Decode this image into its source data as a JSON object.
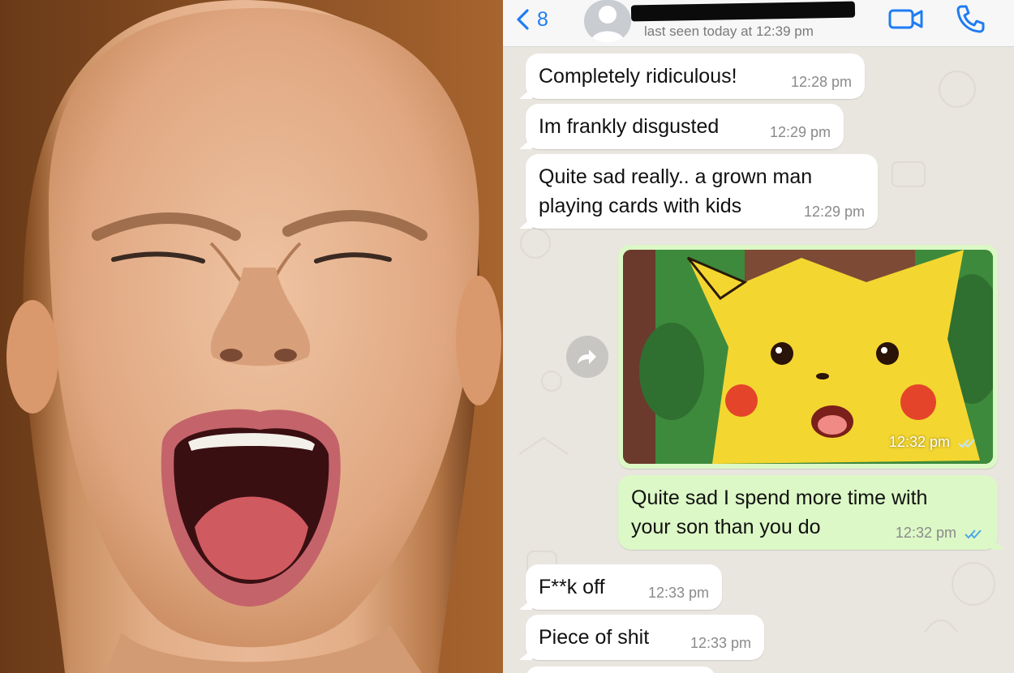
{
  "header": {
    "back_count": "8",
    "last_seen": "last seen today at 12:39 pm",
    "accent_color": "#1f7cf4",
    "icons": [
      "chevron-left-icon",
      "avatar-placeholder-icon",
      "video-call-icon",
      "phone-icon"
    ]
  },
  "messages": [
    {
      "dir": "in",
      "text": "Completely ridiculous!",
      "time": "12:28 pm"
    },
    {
      "dir": "in",
      "text": "Im frankly disgusted",
      "time": "12:29 pm"
    },
    {
      "dir": "in",
      "text": "Quite sad really.. a grown man\nplaying cards with kids",
      "time": "12:29 pm"
    },
    {
      "dir": "out",
      "type": "image",
      "time": "12:32 pm",
      "read": true
    },
    {
      "dir": "out",
      "text": "Quite sad I spend more time with\nyour son than you do",
      "time": "12:32 pm",
      "read": true
    },
    {
      "dir": "in",
      "text": "F**k off",
      "time": "12:33 pm"
    },
    {
      "dir": "in",
      "text": "Piece of shit",
      "time": "12:33 pm"
    }
  ],
  "colors": {
    "incoming_bubble": "#ffffff",
    "outgoing_bubble": "#dcf8c6",
    "chat_background": "#e9e5df",
    "read_ticks": "#4fa8e8"
  }
}
